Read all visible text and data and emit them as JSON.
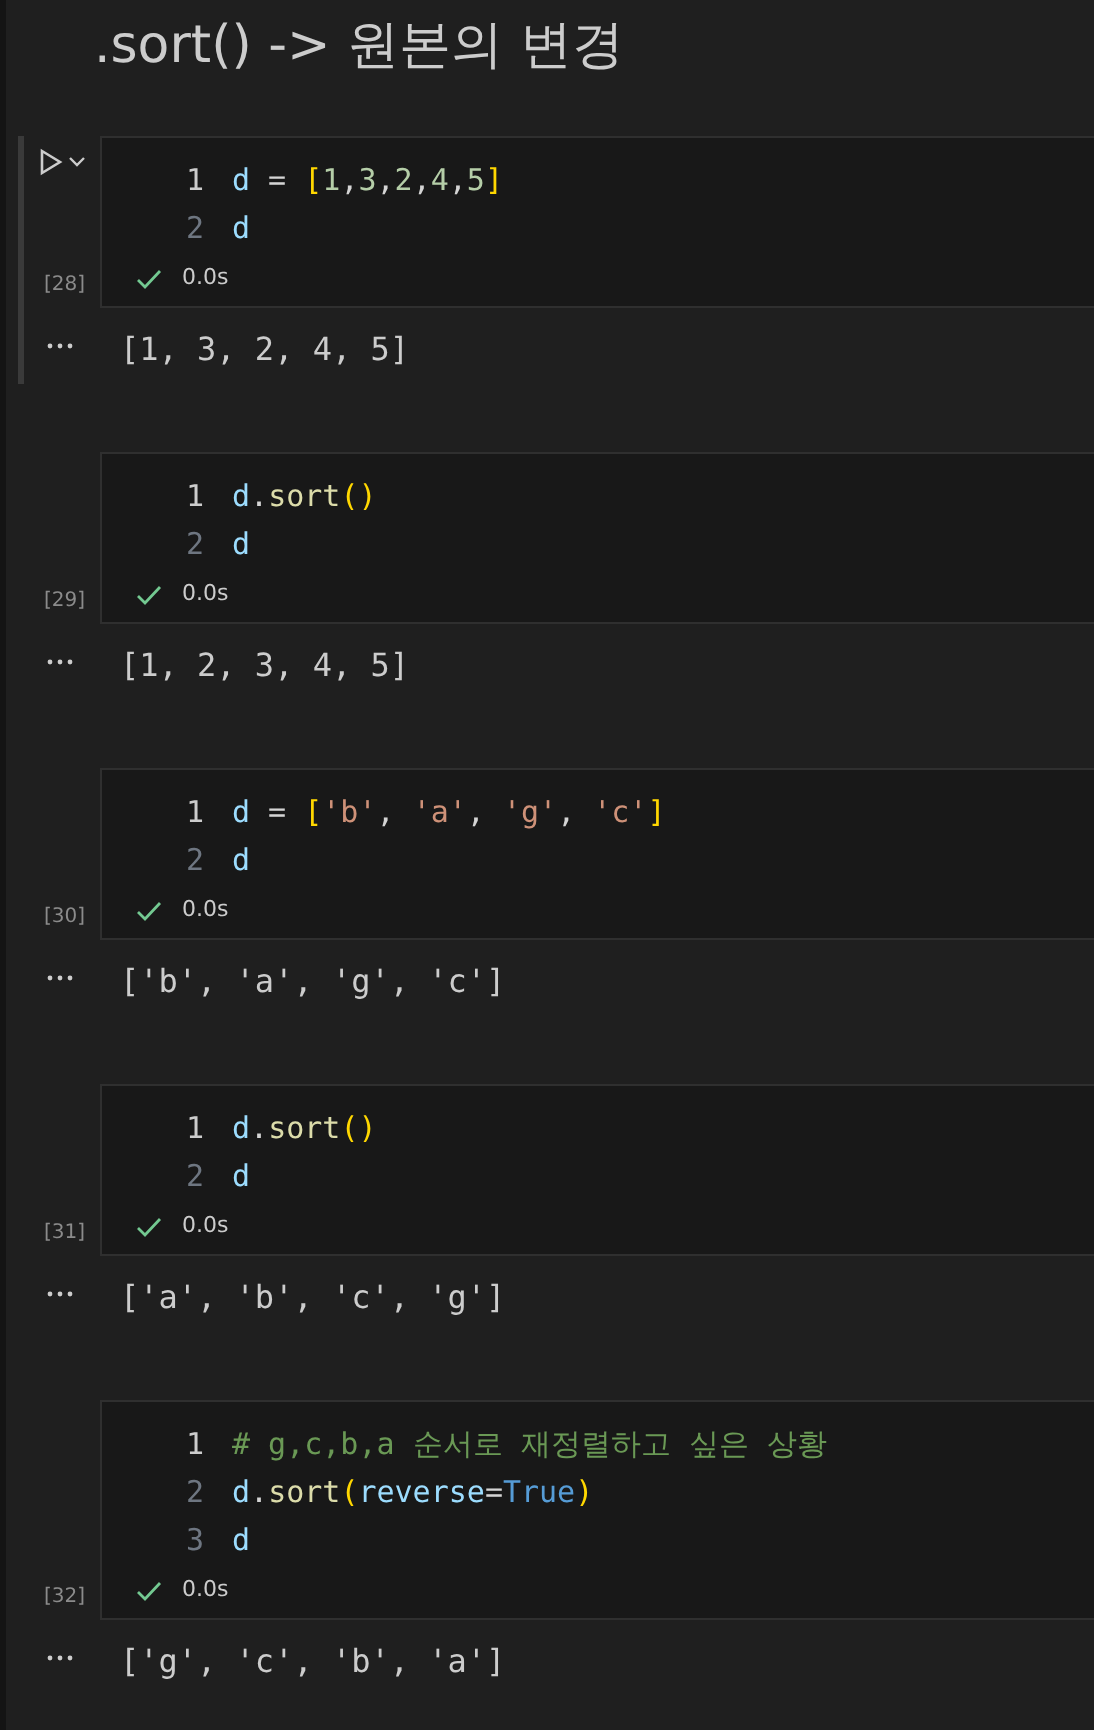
{
  "heading": ".sort() -> 원본의 변경",
  "cells": [
    {
      "selected": true,
      "count": "[28]",
      "status": "0.0s",
      "output": "[1, 3, 2, 4, 5]",
      "lines": [
        {
          "number": "1",
          "current": true,
          "tokens": [
            {
              "kind": "var",
              "text": "d"
            },
            {
              "kind": "op",
              "text": " = "
            },
            {
              "kind": "bracket",
              "text": "["
            },
            {
              "kind": "num",
              "text": "1"
            },
            {
              "kind": "op",
              "text": ","
            },
            {
              "kind": "num",
              "text": "3"
            },
            {
              "kind": "op",
              "text": ","
            },
            {
              "kind": "num",
              "text": "2"
            },
            {
              "kind": "op",
              "text": ","
            },
            {
              "kind": "num",
              "text": "4"
            },
            {
              "kind": "op",
              "text": ","
            },
            {
              "kind": "num",
              "text": "5"
            },
            {
              "kind": "bracket",
              "text": "]"
            }
          ]
        },
        {
          "number": "2",
          "current": false,
          "tokens": [
            {
              "kind": "var",
              "text": "d"
            }
          ]
        }
      ]
    },
    {
      "selected": false,
      "count": "[29]",
      "status": "0.0s",
      "output": "[1, 2, 3, 4, 5]",
      "lines": [
        {
          "number": "1",
          "current": true,
          "tokens": [
            {
              "kind": "var",
              "text": "d"
            },
            {
              "kind": "op",
              "text": "."
            },
            {
              "kind": "func",
              "text": "sort"
            },
            {
              "kind": "bracket",
              "text": "()"
            }
          ]
        },
        {
          "number": "2",
          "current": false,
          "tokens": [
            {
              "kind": "var",
              "text": "d"
            }
          ]
        }
      ]
    },
    {
      "selected": false,
      "count": "[30]",
      "status": "0.0s",
      "output": "['b', 'a', 'g', 'c']",
      "lines": [
        {
          "number": "1",
          "current": true,
          "tokens": [
            {
              "kind": "var",
              "text": "d"
            },
            {
              "kind": "op",
              "text": " = "
            },
            {
              "kind": "bracket",
              "text": "["
            },
            {
              "kind": "str",
              "text": "'b'"
            },
            {
              "kind": "op",
              "text": ", "
            },
            {
              "kind": "str",
              "text": "'a'"
            },
            {
              "kind": "op",
              "text": ", "
            },
            {
              "kind": "str",
              "text": "'g'"
            },
            {
              "kind": "op",
              "text": ", "
            },
            {
              "kind": "str",
              "text": "'c'"
            },
            {
              "kind": "bracket",
              "text": "]"
            }
          ]
        },
        {
          "number": "2",
          "current": false,
          "tokens": [
            {
              "kind": "var",
              "text": "d"
            }
          ]
        }
      ]
    },
    {
      "selected": false,
      "count": "[31]",
      "status": "0.0s",
      "output": "['a', 'b', 'c', 'g']",
      "lines": [
        {
          "number": "1",
          "current": true,
          "tokens": [
            {
              "kind": "var",
              "text": "d"
            },
            {
              "kind": "op",
              "text": "."
            },
            {
              "kind": "func",
              "text": "sort"
            },
            {
              "kind": "bracket",
              "text": "()"
            }
          ]
        },
        {
          "number": "2",
          "current": false,
          "tokens": [
            {
              "kind": "var",
              "text": "d"
            }
          ]
        }
      ]
    },
    {
      "selected": false,
      "count": "[32]",
      "status": "0.0s",
      "output": "['g', 'c', 'b', 'a']",
      "lines": [
        {
          "number": "1",
          "current": true,
          "tokens": [
            {
              "kind": "comment",
              "text": "# g,c,b,a 순서로 재정렬하고 싶은 상황"
            }
          ]
        },
        {
          "number": "2",
          "current": false,
          "tokens": [
            {
              "kind": "var",
              "text": "d"
            },
            {
              "kind": "op",
              "text": "."
            },
            {
              "kind": "func",
              "text": "sort"
            },
            {
              "kind": "bracket",
              "text": "("
            },
            {
              "kind": "var",
              "text": "reverse"
            },
            {
              "kind": "op",
              "text": "="
            },
            {
              "kind": "const",
              "text": "True"
            },
            {
              "kind": "bracket",
              "text": ")"
            }
          ]
        },
        {
          "number": "3",
          "current": false,
          "tokens": [
            {
              "kind": "var",
              "text": "d"
            }
          ]
        }
      ]
    }
  ]
}
